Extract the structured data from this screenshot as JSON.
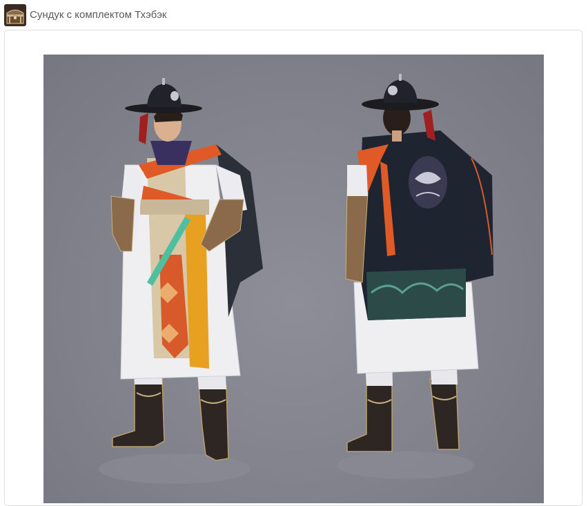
{
  "header": {
    "title": "Сундук с комплектом Тхэбэк",
    "icon": "treasure-chest-icon"
  },
  "colors": {
    "title_text": "#5a5a5a",
    "artwork_background": "#82828c",
    "panel_border": "#dcdcdc"
  }
}
